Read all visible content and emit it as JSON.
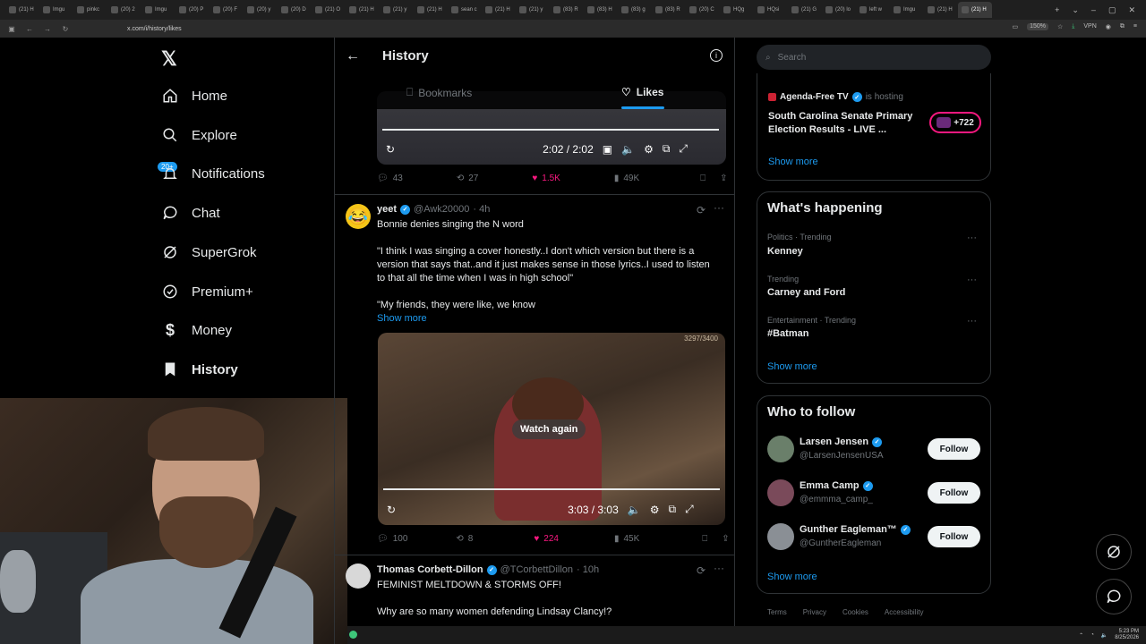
{
  "browser": {
    "tabs": [
      "(21) H",
      "Imgu",
      "pinkc",
      "(20) 2",
      "Imgu",
      "(20) P",
      "(20) F",
      "(20) y",
      "(20) D",
      "(21) O",
      "(21) H",
      "(21) y",
      "(21) H",
      "sean c",
      "(21) H",
      "(21) y",
      "(83) R",
      "(83) H",
      "(83) g",
      "(83) R",
      "(20) C",
      "HQg",
      "HQsi",
      "(21) G",
      "(20) lo",
      "left w",
      "Imgu",
      "(21) H",
      "(21) H"
    ],
    "url": "x.com/i/history/likes",
    "zoom": "150%",
    "vpn": "VPN"
  },
  "nav": {
    "items": [
      {
        "label": "Home",
        "icon": "home-icon"
      },
      {
        "label": "Explore",
        "icon": "search-icon"
      },
      {
        "label": "Notifications",
        "icon": "bell-icon"
      },
      {
        "label": "Chat",
        "icon": "chat-icon"
      },
      {
        "label": "SuperGrok",
        "icon": "grok-icon"
      },
      {
        "label": "Premium+",
        "icon": "verified-icon"
      },
      {
        "label": "Money",
        "icon": "dollar-icon"
      },
      {
        "label": "History",
        "icon": "bookmark-filled-icon"
      }
    ],
    "notif_badge": "20+"
  },
  "header": {
    "title": "History",
    "tab_bookmarks": "Bookmarks",
    "tab_likes": "Likes",
    "active_tab": "Likes"
  },
  "tweet0": {
    "time": "2:02 / 2:02",
    "replies": "43",
    "reposts": "27",
    "likes": "1.5K",
    "views": "49K"
  },
  "tweet1": {
    "name": "yeet",
    "handle": "@Awk20000",
    "age": "· 4h",
    "line1": "Bonnie denies singing the N word",
    "para1": "\"I think I was singing a cover honestly..I don't which version but there is a version that says that..and it just makes sense in those lyrics..I used to listen to that all the time when I was in high school\"",
    "para2": "\"My friends, they were like, we know",
    "show_more": "Show more",
    "video_counter": "3297/3400",
    "watch_again": "Watch again",
    "time": "3:03 / 3:03",
    "replies": "100",
    "reposts": "8",
    "likes": "224",
    "views": "45K"
  },
  "tweet2": {
    "name": "Thomas Corbett-Dillon",
    "handle": "@TCorbettDillon",
    "age": "· 10h",
    "line1": "FEMINIST MELTDOWN & STORMS OFF!",
    "line2": "Why are so many women defending Lindsay Clancy!?"
  },
  "search": {
    "placeholder": "Search"
  },
  "live": {
    "host": "Agenda-Free TV",
    "hosting": "is hosting",
    "title": "South Carolina Senate Primary Election Results - LIVE ...",
    "count": "+722",
    "show_more": "Show more"
  },
  "happening": {
    "title": "What's happening",
    "trends": [
      {
        "meta": "Politics · Trending",
        "name": "Kenney"
      },
      {
        "meta": "Trending",
        "name": "Carney and Ford"
      },
      {
        "meta": "Entertainment · Trending",
        "name": "#Batman"
      }
    ],
    "show_more": "Show more"
  },
  "who_to_follow": {
    "title": "Who to follow",
    "users": [
      {
        "name": "Larsen Jensen",
        "handle": "@LarsenJensenUSA",
        "button": "Follow"
      },
      {
        "name": "Emma Camp",
        "handle": "@emmma_camp_",
        "button": "Follow"
      },
      {
        "name": "Gunther Eagleman™",
        "handle": "@GuntherEagleman",
        "button": "Follow"
      }
    ],
    "show_more": "Show more"
  },
  "footer": {
    "links": [
      "Terms",
      "Privacy",
      "Cookies",
      "Accessibility"
    ]
  },
  "taskbar": {
    "time": "5:23 PM",
    "date": "8/25/2026"
  },
  "colors": {
    "accent": "#1d9bf0",
    "like": "#f91880",
    "background": "#000000"
  }
}
